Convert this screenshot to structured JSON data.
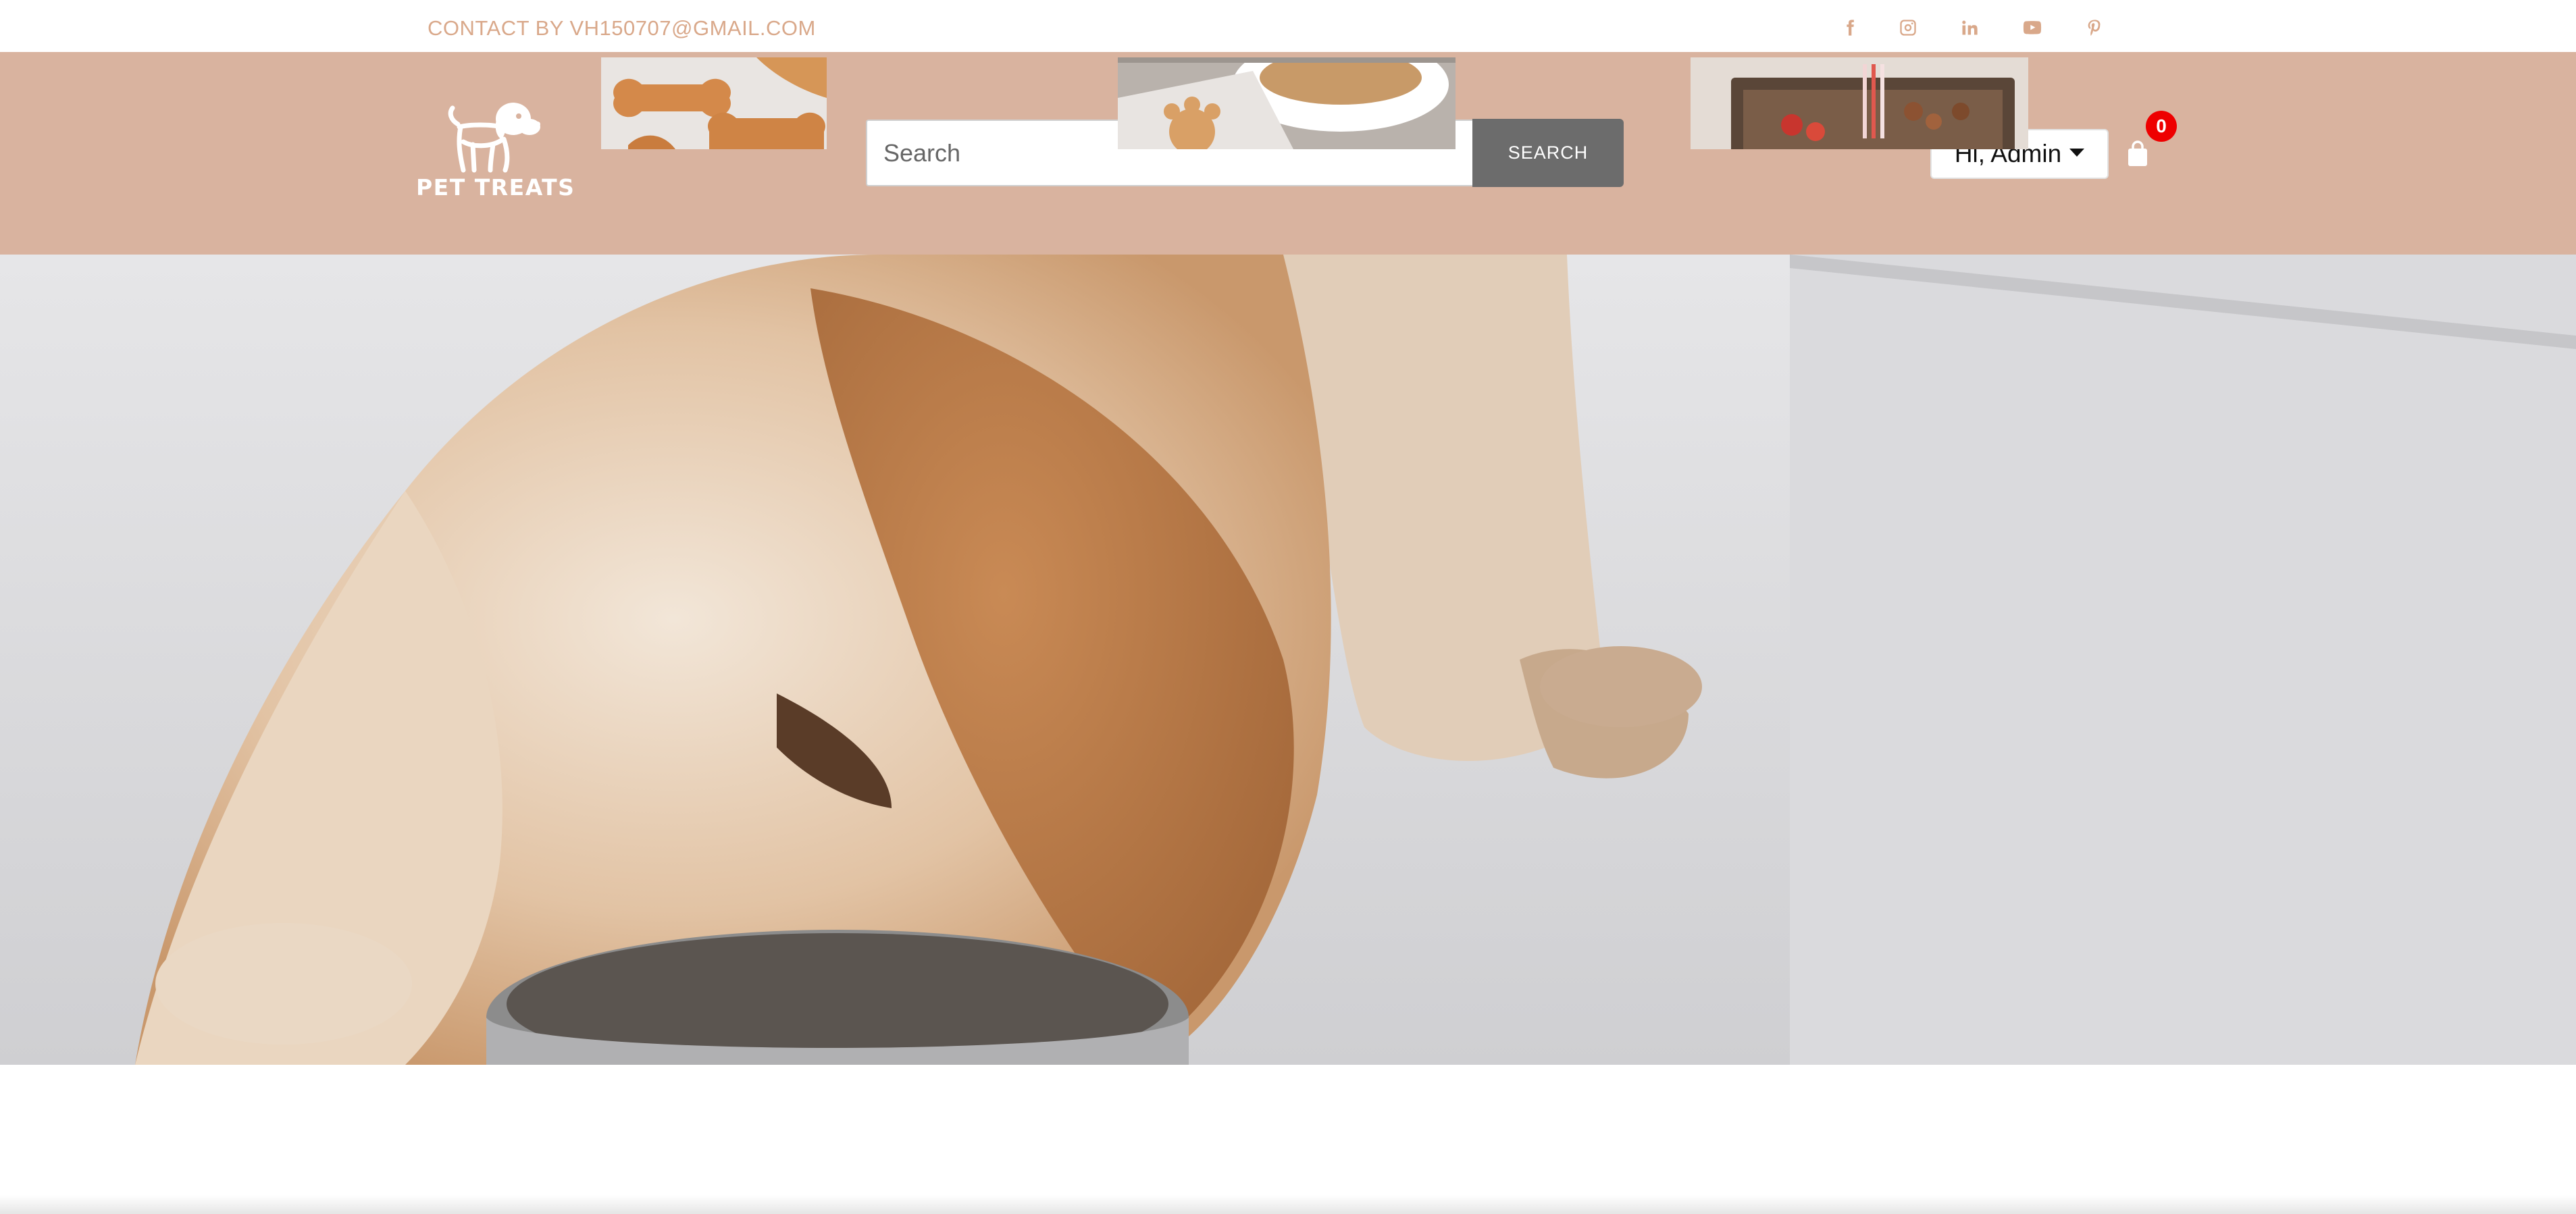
{
  "topbar": {
    "contact_text": "CONTACT BY VH150707@GMAIL.COM",
    "social_icons": [
      "facebook-icon",
      "instagram-icon",
      "linkedin-icon",
      "youtube-icon",
      "pinterest-icon"
    ]
  },
  "header": {
    "logo_text": "PET TREATS",
    "search": {
      "placeholder": "Search",
      "button_label": "SEARCH"
    },
    "user_menu_label": "Hi, Admin",
    "cart_count": "0"
  },
  "colors": {
    "accent": "#d9a88a",
    "header_bg": "#d9b39f",
    "search_button": "#6c6c6c",
    "badge": "#ee0000"
  },
  "hero": {
    "image": "dog-eating-from-bowl"
  },
  "products": [
    {
      "image": "bone-shaped-cookies"
    },
    {
      "image": "paw-treats-bowl"
    },
    {
      "image": "treat-gift-box"
    }
  ]
}
